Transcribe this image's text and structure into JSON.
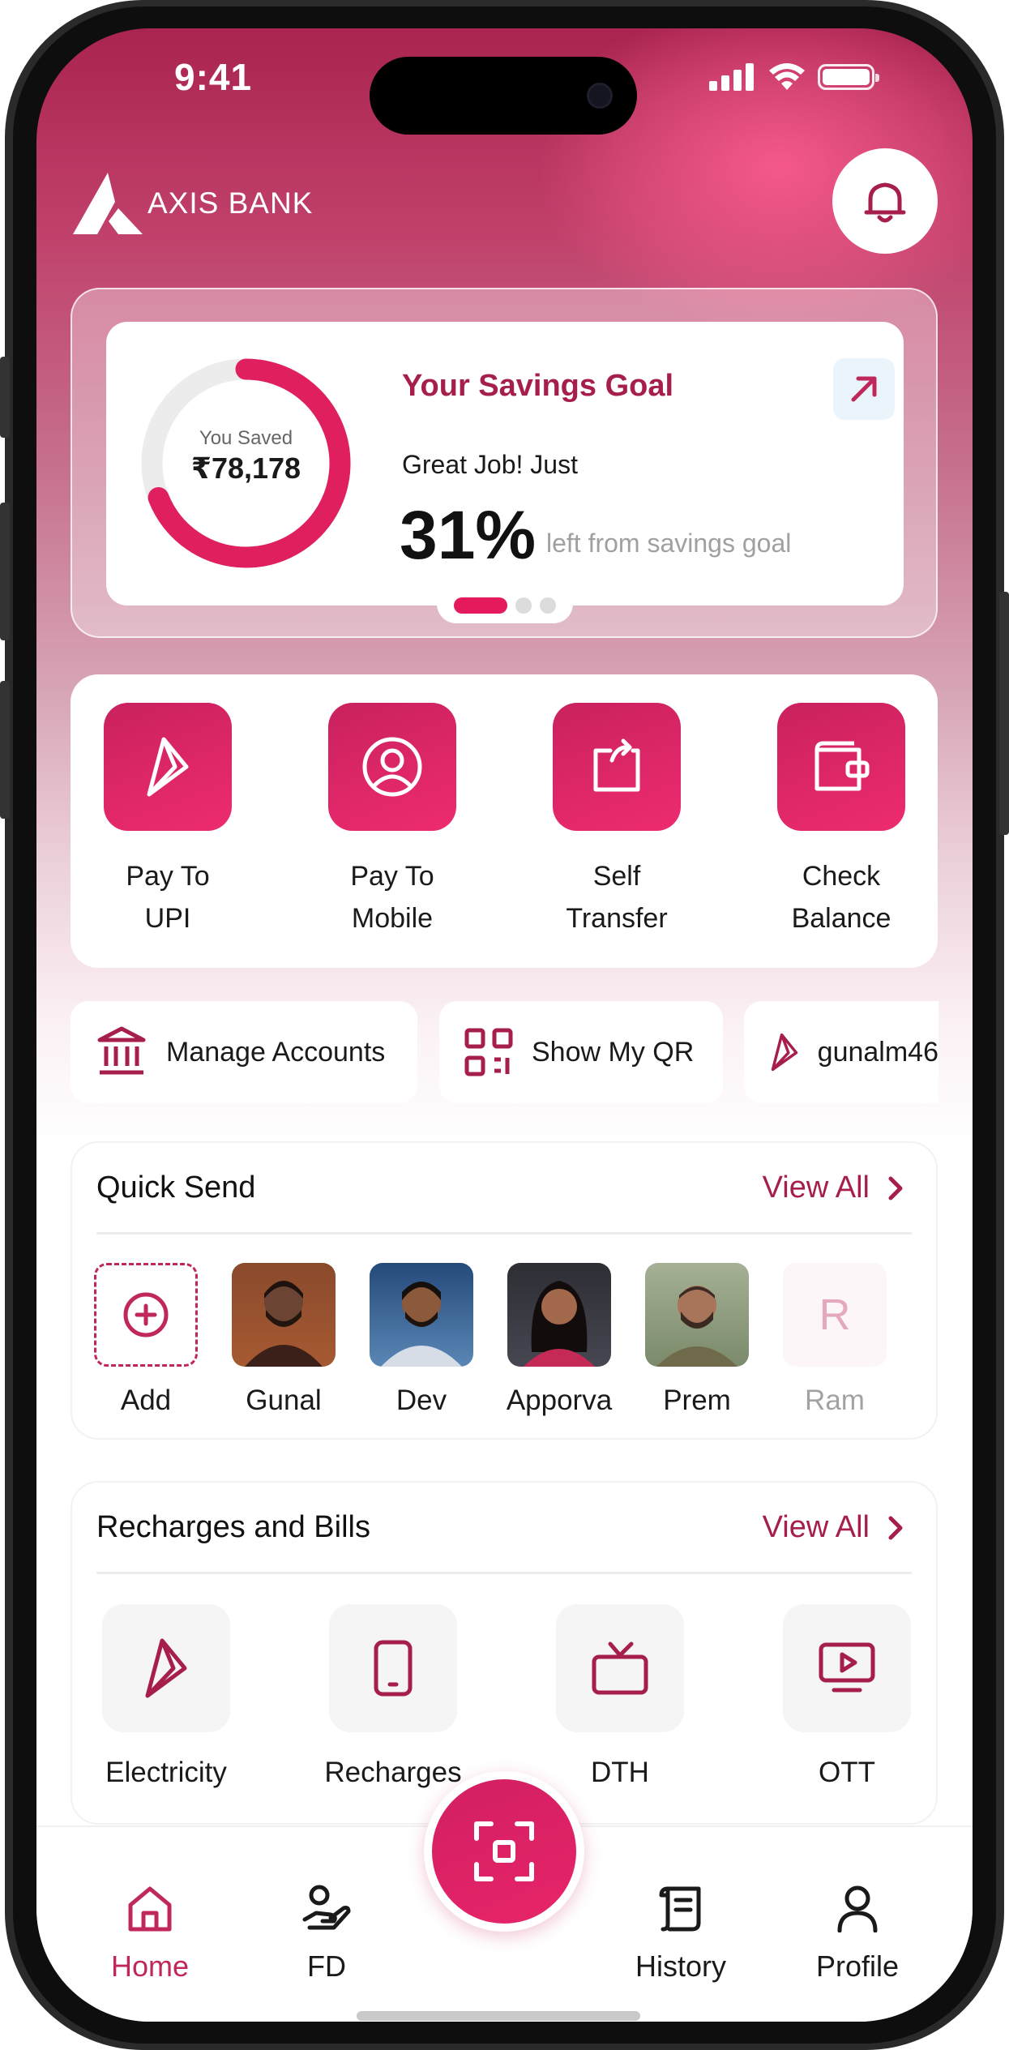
{
  "status_bar": {
    "time": "9:41"
  },
  "header": {
    "brand": "AXIS BANK"
  },
  "savings": {
    "saved_label": "You Saved",
    "saved_amount": "₹78,178",
    "title": "Your Savings Goal",
    "message": "Great Job! Just",
    "percent": "31%",
    "sub": "left from savings goal",
    "progress_fraction": 0.69,
    "pager": {
      "pages": 3,
      "active": 0
    }
  },
  "actions": [
    {
      "line1": "Pay To",
      "line2": "UPI",
      "icon": "upi-icon"
    },
    {
      "line1": "Pay To",
      "line2": "Mobile",
      "icon": "user-circle-icon"
    },
    {
      "line1": "Self",
      "line2": "Transfer",
      "icon": "transfer-icon"
    },
    {
      "line1": "Check",
      "line2": "Balance",
      "icon": "wallet-icon"
    }
  ],
  "chips": [
    {
      "label": "Manage Accounts",
      "icon": "bank-icon"
    },
    {
      "label": "Show My QR",
      "icon": "qr-icon"
    },
    {
      "label": "gunalm46",
      "icon": "upi-icon"
    }
  ],
  "quick_send": {
    "title": "Quick Send",
    "view_all": "View All",
    "contacts": [
      {
        "name": "Add"
      },
      {
        "name": "Gunal"
      },
      {
        "name": "Dev"
      },
      {
        "name": "Apporva"
      },
      {
        "name": "Prem"
      },
      {
        "name": "Ram",
        "initial": "R"
      }
    ]
  },
  "bills": {
    "title": "Recharges and Bills",
    "view_all": "View All",
    "items": [
      {
        "label": "Electricity",
        "icon": "electricity-icon"
      },
      {
        "label": "Recharges",
        "icon": "phone-icon"
      },
      {
        "label": "DTH",
        "icon": "tv-icon"
      },
      {
        "label": "OTT",
        "icon": "play-screen-icon"
      }
    ]
  },
  "bottom_nav": {
    "items": [
      {
        "label": "Home",
        "icon": "home-icon",
        "active": true
      },
      {
        "label": "FD",
        "icon": "fd-icon"
      },
      {
        "label": "History",
        "icon": "history-icon"
      },
      {
        "label": "Profile",
        "icon": "profile-icon"
      }
    ],
    "scan_icon": "scan-icon"
  },
  "colors": {
    "accent": "#e51a5d",
    "brand_dark": "#a61f4b",
    "muted": "#a0a0a0"
  }
}
